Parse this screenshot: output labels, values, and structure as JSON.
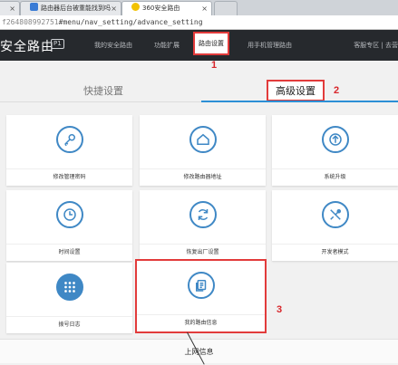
{
  "browser": {
    "tabs": [
      {
        "label": "",
        "icon": "page-icon"
      },
      {
        "label": "路由器后台被重能找到吗",
        "icon": "page-icon"
      },
      {
        "label": "360安全路由",
        "icon": "360-logo-icon"
      },
      {
        "label": "",
        "icon": "new-tab-icon"
      }
    ],
    "address_prefix": "f264808992751",
    "address_path": "#menu/nav_setting/advance_setting"
  },
  "nav": {
    "brand": "安全路由",
    "badge": "P1",
    "items": [
      "我的安全路由",
      "功能扩展",
      "路由设置",
      "用手机管理路由"
    ],
    "active_index": 2,
    "right": "客服专区 | 去营"
  },
  "annotations": {
    "one": "1",
    "two": "2",
    "three": "3"
  },
  "setting_tabs": {
    "quick": "快捷设置",
    "advanced": "高级设置"
  },
  "cards": [
    {
      "label": "修改管理密码",
      "icon": "key-icon"
    },
    {
      "label": "修改路由器地址",
      "icon": "home-icon"
    },
    {
      "label": "系统升级",
      "icon": "upgrade-icon"
    },
    {
      "label": "时间设置",
      "icon": "clock-icon"
    },
    {
      "label": "恢复出厂设置",
      "icon": "refresh-icon"
    },
    {
      "label": "开发者模式",
      "icon": "tools-icon"
    },
    {
      "label": "拨号日志",
      "icon": "grid-icon"
    },
    {
      "label": "我的路由信息",
      "icon": "document-icon"
    }
  ],
  "bottom": {
    "title": "上网信息"
  },
  "colors": {
    "accent_blue": "#2c8fd6",
    "highlight_red": "#e23b3b",
    "nav_bg": "#26292d"
  }
}
